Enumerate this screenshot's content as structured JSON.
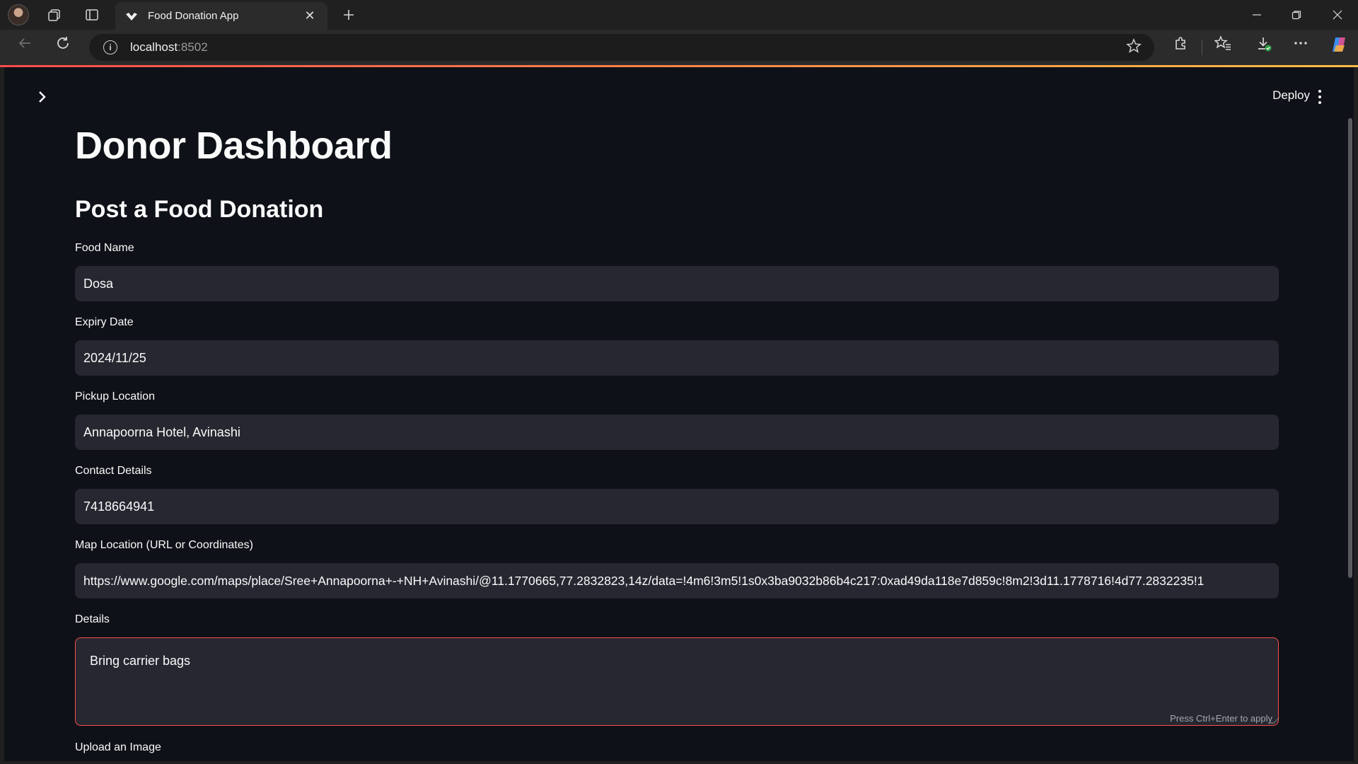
{
  "browser": {
    "tab_title": "Food Donation App",
    "address_host": "localhost",
    "address_port": ":8502"
  },
  "app": {
    "deploy_label": "Deploy",
    "title": "Donor Dashboard",
    "subtitle": "Post a Food Donation",
    "fields": {
      "food_name": {
        "label": "Food Name",
        "value": "Dosa"
      },
      "expiry_date": {
        "label": "Expiry Date",
        "value": "2024/11/25"
      },
      "pickup_location": {
        "label": "Pickup Location",
        "value": "Annapoorna Hotel, Avinashi"
      },
      "contact_details": {
        "label": "Contact Details",
        "value": "7418664941"
      },
      "map_location": {
        "label": "Map Location (URL or Coordinates)",
        "value": "https://www.google.com/maps/place/Sree+Annapoorna+-+NH+Avinashi/@11.1770665,77.2832823,14z/data=!4m6!3m5!1s0x3ba9032b86b4c217:0xad49da118e7d859c!8m2!3d11.1778716!4d77.2832235!1"
      },
      "details": {
        "label": "Details",
        "value": "Bring carrier bags",
        "hint": "Press Ctrl+Enter to apply"
      },
      "upload": {
        "label": "Upload an Image"
      }
    }
  },
  "colors": {
    "app_bg": "#0e1117",
    "input_bg": "#262730",
    "accent": "#ff4b4b"
  }
}
